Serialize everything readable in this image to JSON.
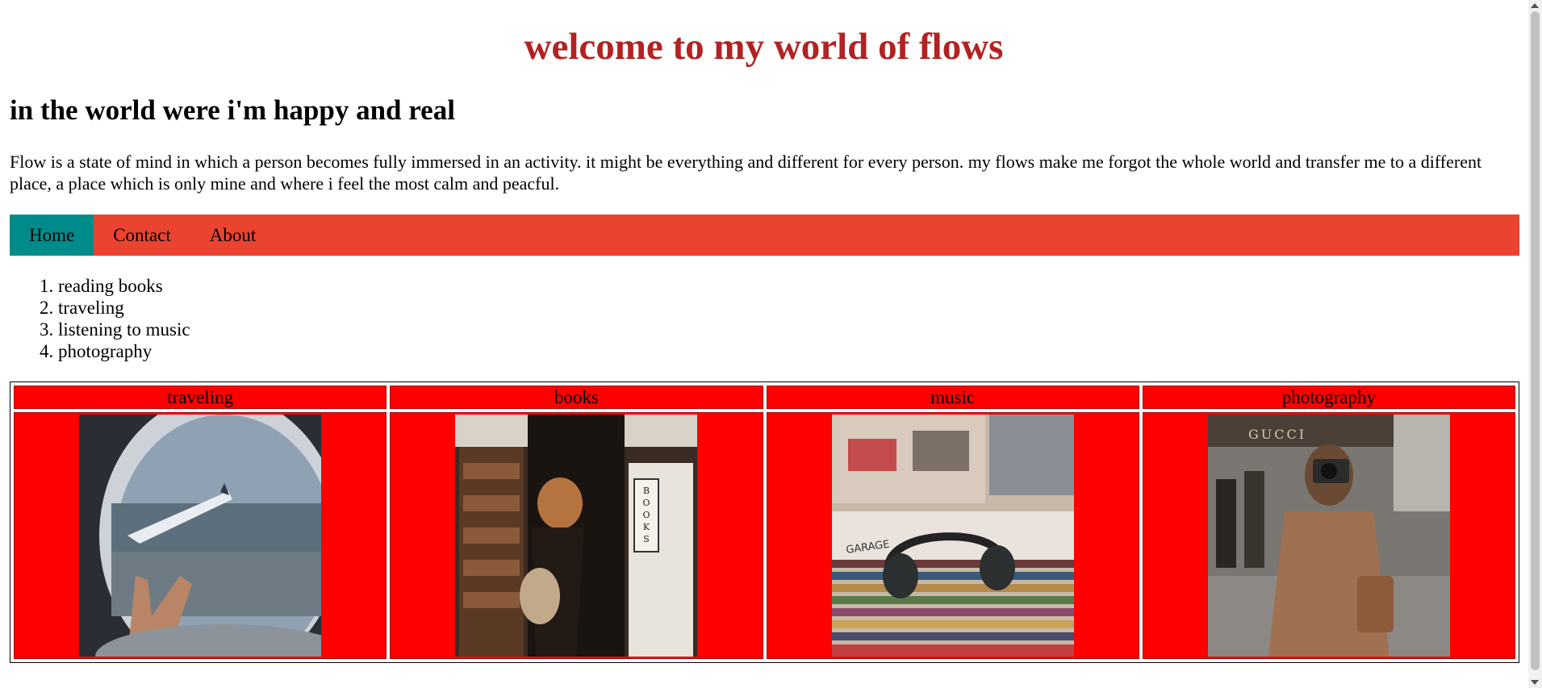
{
  "header": {
    "title": "welcome to my world of flows",
    "subtitle": "in the world were i'm happy and real",
    "intro": "Flow is a state of mind in which a person becomes fully immersed in an activity. it might be everything and different for every person. my flows make me forgot the whole world and transfer me to a different place, a place which is only mine and where i feel the most calm and peacful."
  },
  "nav": {
    "items": [
      {
        "label": "Home",
        "active": true
      },
      {
        "label": "Contact",
        "active": false
      },
      {
        "label": "About",
        "active": false
      }
    ]
  },
  "flows": {
    "items": [
      "reading books",
      "traveling",
      "listening to music",
      "photography"
    ]
  },
  "gallery": {
    "headers": [
      "traveling",
      "books",
      "music",
      "photography"
    ],
    "images": [
      "airplane-window-photo",
      "bookstore-photo",
      "vinyl-headphones-photo",
      "woman-camera-photo"
    ],
    "photo_text": {
      "books_sign": "BOOKS",
      "garage_label": "GARAGE",
      "gucci_sign": "GUCCI"
    }
  },
  "colors": {
    "title": "#b22222",
    "navbar": "#ea4330",
    "nav_active": "#008b8b",
    "table_cell": "#ff0000"
  }
}
